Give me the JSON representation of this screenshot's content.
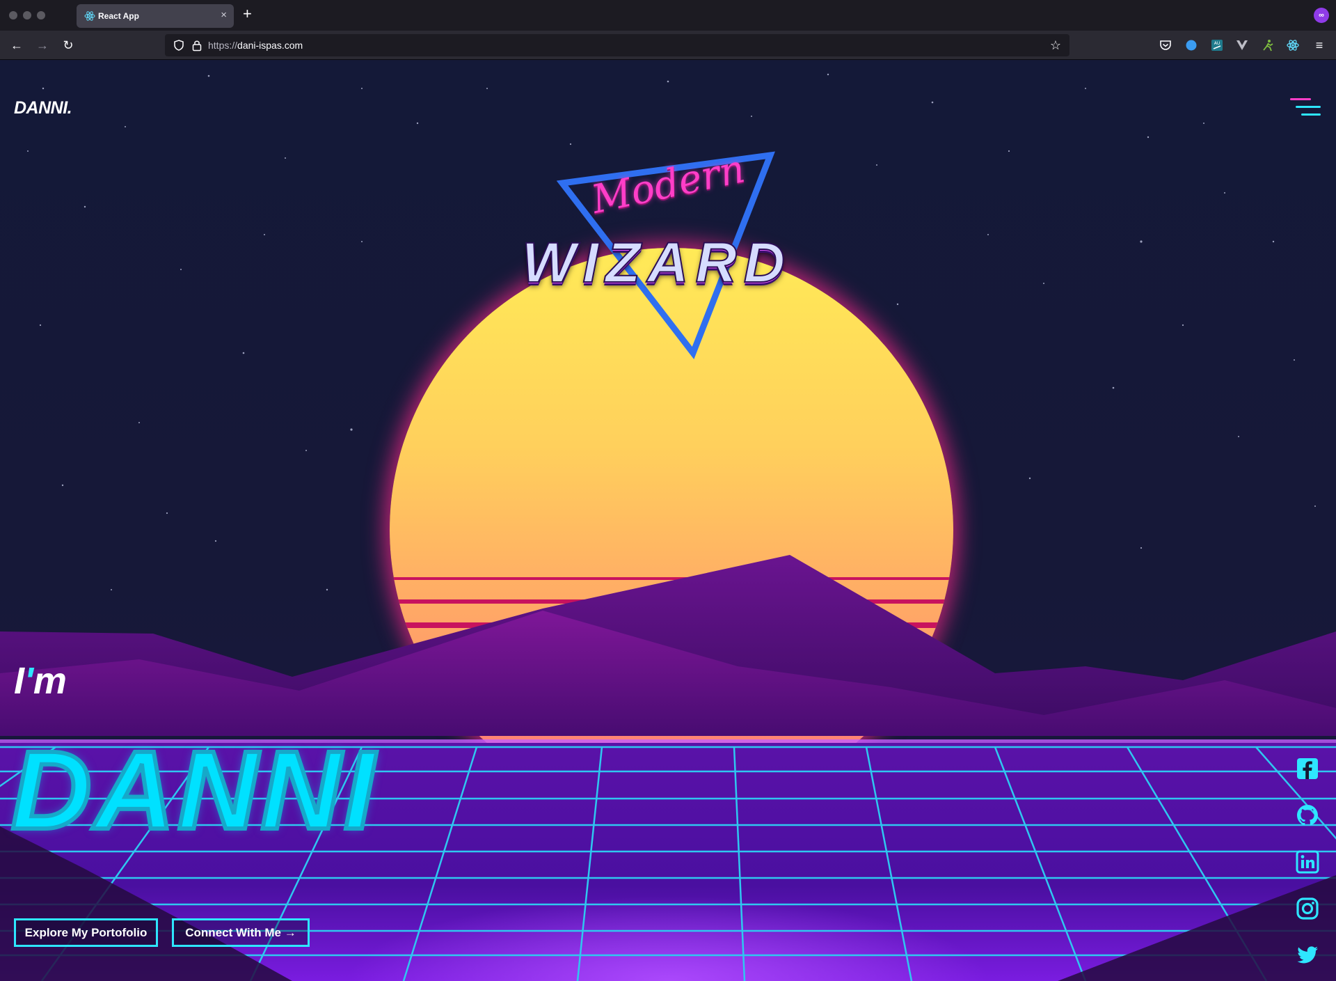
{
  "browser": {
    "tab_title": "React App",
    "tab_close": "×",
    "new_tab": "+",
    "url_prefix": "https://",
    "url_domain": "dani-ispas.com",
    "extensions": [
      "pocket-icon",
      "blue-dot-extension-icon",
      "au-translate-extension-icon",
      "vue-devtools-icon",
      "runner-extension-icon",
      "react-devtools-icon"
    ]
  },
  "site": {
    "logo": "DANNI.",
    "hero_badge_script": "Modern",
    "hero_badge_title": "WIZARD",
    "intro_prefix": "I",
    "intro_apostrophe": "'",
    "intro_suffix": "m",
    "name": "DANNI",
    "buttons": {
      "explore": "Explore My Portofolio",
      "connect": "Connect With Me →"
    },
    "socials": [
      "facebook-icon",
      "github-icon",
      "linkedin-icon",
      "instagram-icon",
      "twitter-icon"
    ]
  },
  "colors": {
    "accent_cyan": "#2ee6ff",
    "grid_cyan": "#2fc7f0",
    "magenta": "#ff3ec8",
    "sun_stripe": "#c8135e",
    "background": "#151833"
  }
}
